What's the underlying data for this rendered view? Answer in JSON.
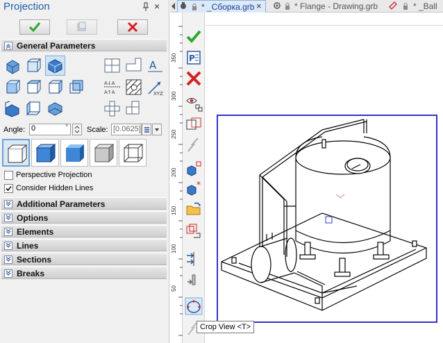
{
  "panel": {
    "title": "Projection",
    "pin_icon": "pin-icon",
    "close_glyph": "×",
    "ok_icon": "checkmark-icon",
    "mid_icon": "preview-icon",
    "cancel_icon": "cross-icon"
  },
  "sections": {
    "general": "General Parameters",
    "additional": "Additional Parameters",
    "options": "Options",
    "elements": "Elements",
    "lines": "Lines",
    "sections": "Sections",
    "breaks": "Breaks"
  },
  "params": {
    "angle_label": "Angle:",
    "angle_value": "0",
    "angle_unit": "°",
    "scale_label": "Scale:",
    "scale_value": "[0.0625]"
  },
  "checkboxes": {
    "perspective": {
      "label": "Perspective Projection",
      "checked": false
    },
    "hidden_lines": {
      "label": "Consider Hidden Lines",
      "checked": true
    }
  },
  "tabs": [
    {
      "label": "* _Сборка.grb",
      "active": true
    },
    {
      "label": "* Flange - Drawing.grb",
      "active": false
    },
    {
      "label": "* _Ball",
      "active": false
    }
  ],
  "ruler": {
    "vertical_labels": [
      "350",
      "300",
      "250",
      "200",
      "150",
      "100",
      "50"
    ]
  },
  "tooltip": {
    "text": "Crop View <T>"
  },
  "colors": {
    "accent": "#1f5fa8",
    "ok_green": "#2ea82e",
    "cancel_red": "#d42020",
    "frame_blue": "#3232c8"
  }
}
